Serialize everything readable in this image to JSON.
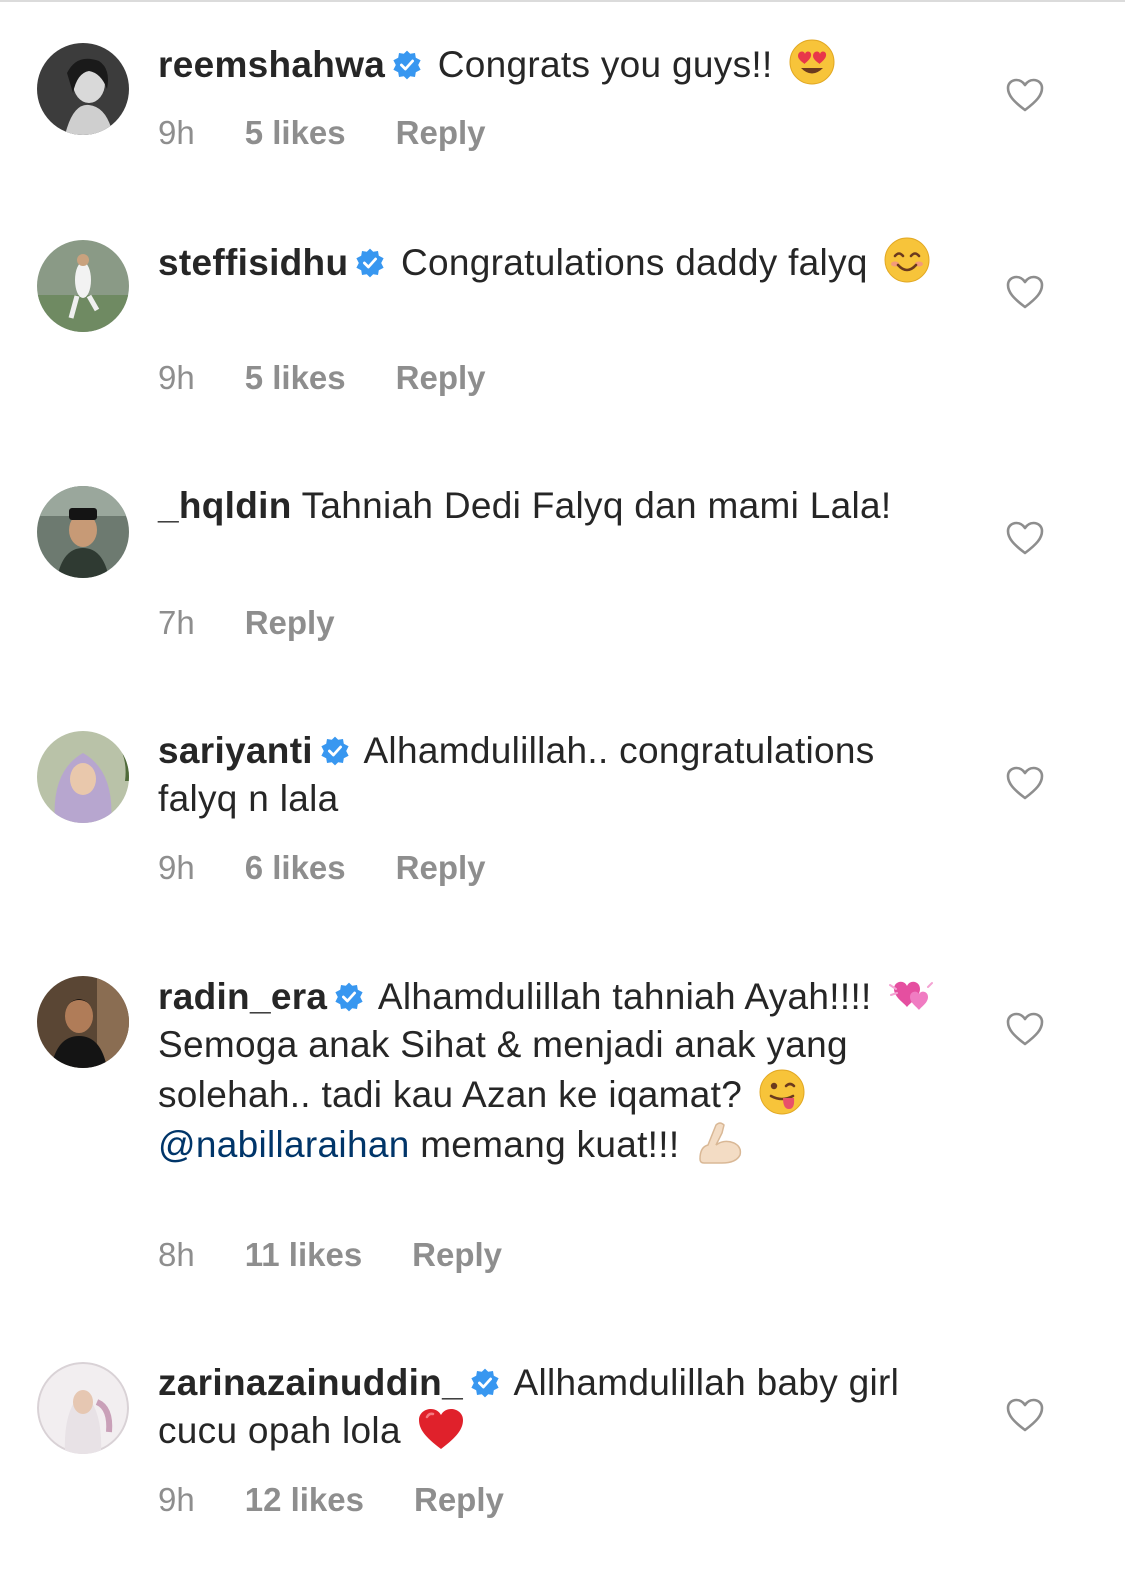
{
  "comments": [
    {
      "username": "reemshahwa",
      "verified": true,
      "text": "Congrats you guys!!",
      "emoji": "heart-eyes",
      "time": "9h",
      "likes": "5 likes",
      "reply": "Reply"
    },
    {
      "username": "steffisidhu",
      "verified": true,
      "text": "Congratulations daddy falyq",
      "emoji": "smile",
      "time": "9h",
      "likes": "5 likes",
      "reply": "Reply"
    },
    {
      "username": "_hqldin",
      "verified": false,
      "text": "Tahniah Dedi Falyq dan mami Lala!",
      "time": "7h",
      "reply": "Reply"
    },
    {
      "username": "sariyanti",
      "verified": true,
      "text": "Alhamdulillah.. congratulations falyq n lala",
      "time": "9h",
      "likes": "6 likes",
      "reply": "Reply"
    },
    {
      "username": "radin_era",
      "verified": true,
      "text_part1": "Alhamdulillah tahniah Ayah!!!!",
      "text_part2": "Semoga anak Sihat & menjadi anak yang solehah.. tadi kau Azan ke iqamat?",
      "mention": "@nabillaraihan",
      "text_part3": "memang kuat!!!",
      "time": "8h",
      "likes": "11 likes",
      "reply": "Reply"
    },
    {
      "username": "zarinazainuddin_",
      "verified": true,
      "text": "Allhamdulillah baby girl cucu opah lola",
      "emoji": "red-heart",
      "time": "9h",
      "likes": "12 likes",
      "reply": "Reply"
    }
  ],
  "colors": {
    "text": "#262626",
    "meta": "#8e8e8e",
    "verified": "#3897f0",
    "mention": "#003569"
  }
}
